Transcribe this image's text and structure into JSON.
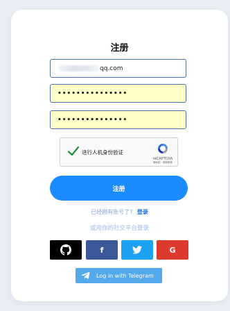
{
  "form": {
    "title": "注册",
    "email_prefix": "",
    "email_suffix": "qq.com",
    "password_mask": "•••••••••••••••",
    "password_confirm_mask": "•••••••••••••••"
  },
  "captcha": {
    "label": "进行人机身份验证",
    "brand": "reCAPTCHA",
    "links": "隐私权 - 使用条款",
    "check_color": "#1e8e3e"
  },
  "actions": {
    "register_label": "注册",
    "have_account_text": "已经拥有账号了?",
    "login_link": "登录",
    "social_title": "或用你的社交平台登录",
    "facebook_label": "f",
    "google_label": "G",
    "telegram_label": "Log in with Telegram"
  },
  "colors": {
    "primary": "#1a8cff",
    "github": "#000000",
    "facebook": "#3b5998",
    "twitter": "#1da1f2",
    "google": "#dd3a2f",
    "telegram": "#54a9eb",
    "autofill": "#ffffc8"
  },
  "icons": {
    "github": "github-icon",
    "facebook": "facebook-icon",
    "twitter": "twitter-icon",
    "google": "google-icon",
    "telegram": "telegram-icon",
    "recaptcha": "recaptcha-logo-icon",
    "check": "checkmark-icon"
  }
}
